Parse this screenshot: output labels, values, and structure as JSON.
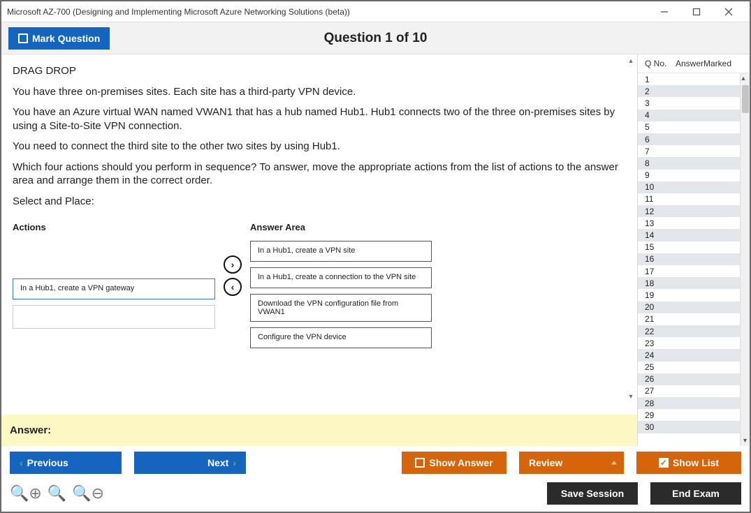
{
  "window": {
    "title": "Microsoft AZ-700 (Designing and Implementing Microsoft Azure Networking Solutions (beta))"
  },
  "header": {
    "mark_label": "Mark Question",
    "question_title": "Question 1 of 10"
  },
  "question": {
    "heading": "DRAG DROP",
    "p1": "You have three on-premises sites. Each site has a third-party VPN device.",
    "p2": "You have an Azure virtual WAN named VWAN1 that has a hub named Hub1. Hub1 connects two of the three on-premises sites by using a Site-to-Site VPN connection.",
    "p3": "You need to connect the third site to the other two sites by using Hub1.",
    "p4": "Which four actions should you perform in sequence? To answer, move the appropriate actions from the list of actions to the answer area and arrange them in the correct order.",
    "p5": "Select and Place:"
  },
  "dnd": {
    "actions_title": "Actions",
    "answer_title": "Answer Area",
    "action_items": [
      "In a Hub1, create a VPN gateway"
    ],
    "answer_items": [
      "In a Hub1, create a VPN site",
      "In a Hub1, create a connection to the VPN site",
      "Download the VPN configuration file from VWAN1",
      "Configure the VPN device"
    ]
  },
  "answer_strip": "Answer:",
  "sidebar": {
    "col_qno": "Q No.",
    "col_answer": "Answer",
    "col_marked": "Marked",
    "rows": [
      1,
      2,
      3,
      4,
      5,
      6,
      7,
      8,
      9,
      10,
      11,
      12,
      13,
      14,
      15,
      16,
      17,
      18,
      19,
      20,
      21,
      22,
      23,
      24,
      25,
      26,
      27,
      28,
      29,
      30
    ]
  },
  "nav": {
    "previous": "Previous",
    "next": "Next",
    "show_answer": "Show Answer",
    "review": "Review",
    "show_list": "Show List"
  },
  "util": {
    "save_session": "Save Session",
    "end_exam": "End Exam"
  }
}
